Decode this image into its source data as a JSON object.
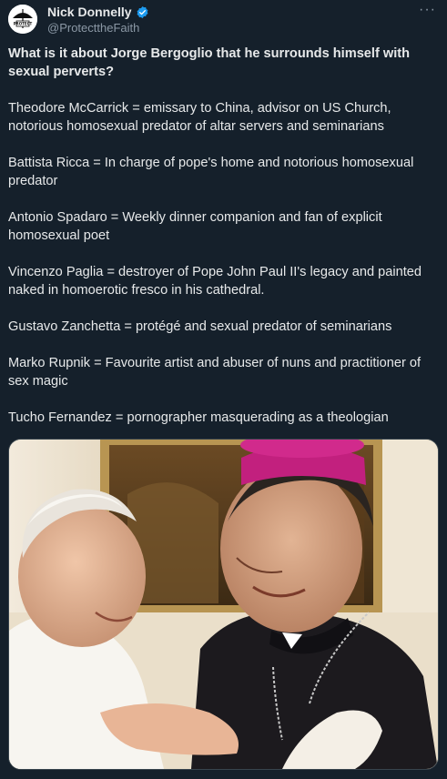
{
  "author": {
    "display_name": "Nick Donnelly",
    "handle": "@ProtecttheFaith",
    "avatar_text": "PROTECT",
    "verified": true
  },
  "tweet": {
    "headline": "What is it about Jorge Bergoglio that he surrounds himself with sexual perverts?",
    "paragraphs": [
      "Theodore McCarrick = emissary to China, advisor on US Church, notorious homosexual predator of altar servers and seminarians",
      "Battista Ricca = In charge of pope's home and notorious homosexual predator",
      "Antonio Spadaro = Weekly dinner companion and fan of explicit homosexual poet",
      "Vincenzo Paglia = destroyer of Pope John Paul II's legacy and painted naked in homoerotic fresco in his cathedral.",
      "Gustavo Zanchetta = protégé and sexual predator of seminarians",
      "Marko Rupnik = Favourite artist and abuser of nuns and practitioner of sex magic",
      "Tucho Fernandez = pornographer masquerading as a theologian"
    ]
  },
  "icons": {
    "verified": "verified-badge-icon",
    "more": "more-options-icon"
  },
  "colors": {
    "background": "#15202b",
    "text": "#e7e9ea",
    "secondary_text": "#8b98a5",
    "verified_blue": "#1d9bf0"
  },
  "ui": {
    "more_glyph": "···"
  }
}
